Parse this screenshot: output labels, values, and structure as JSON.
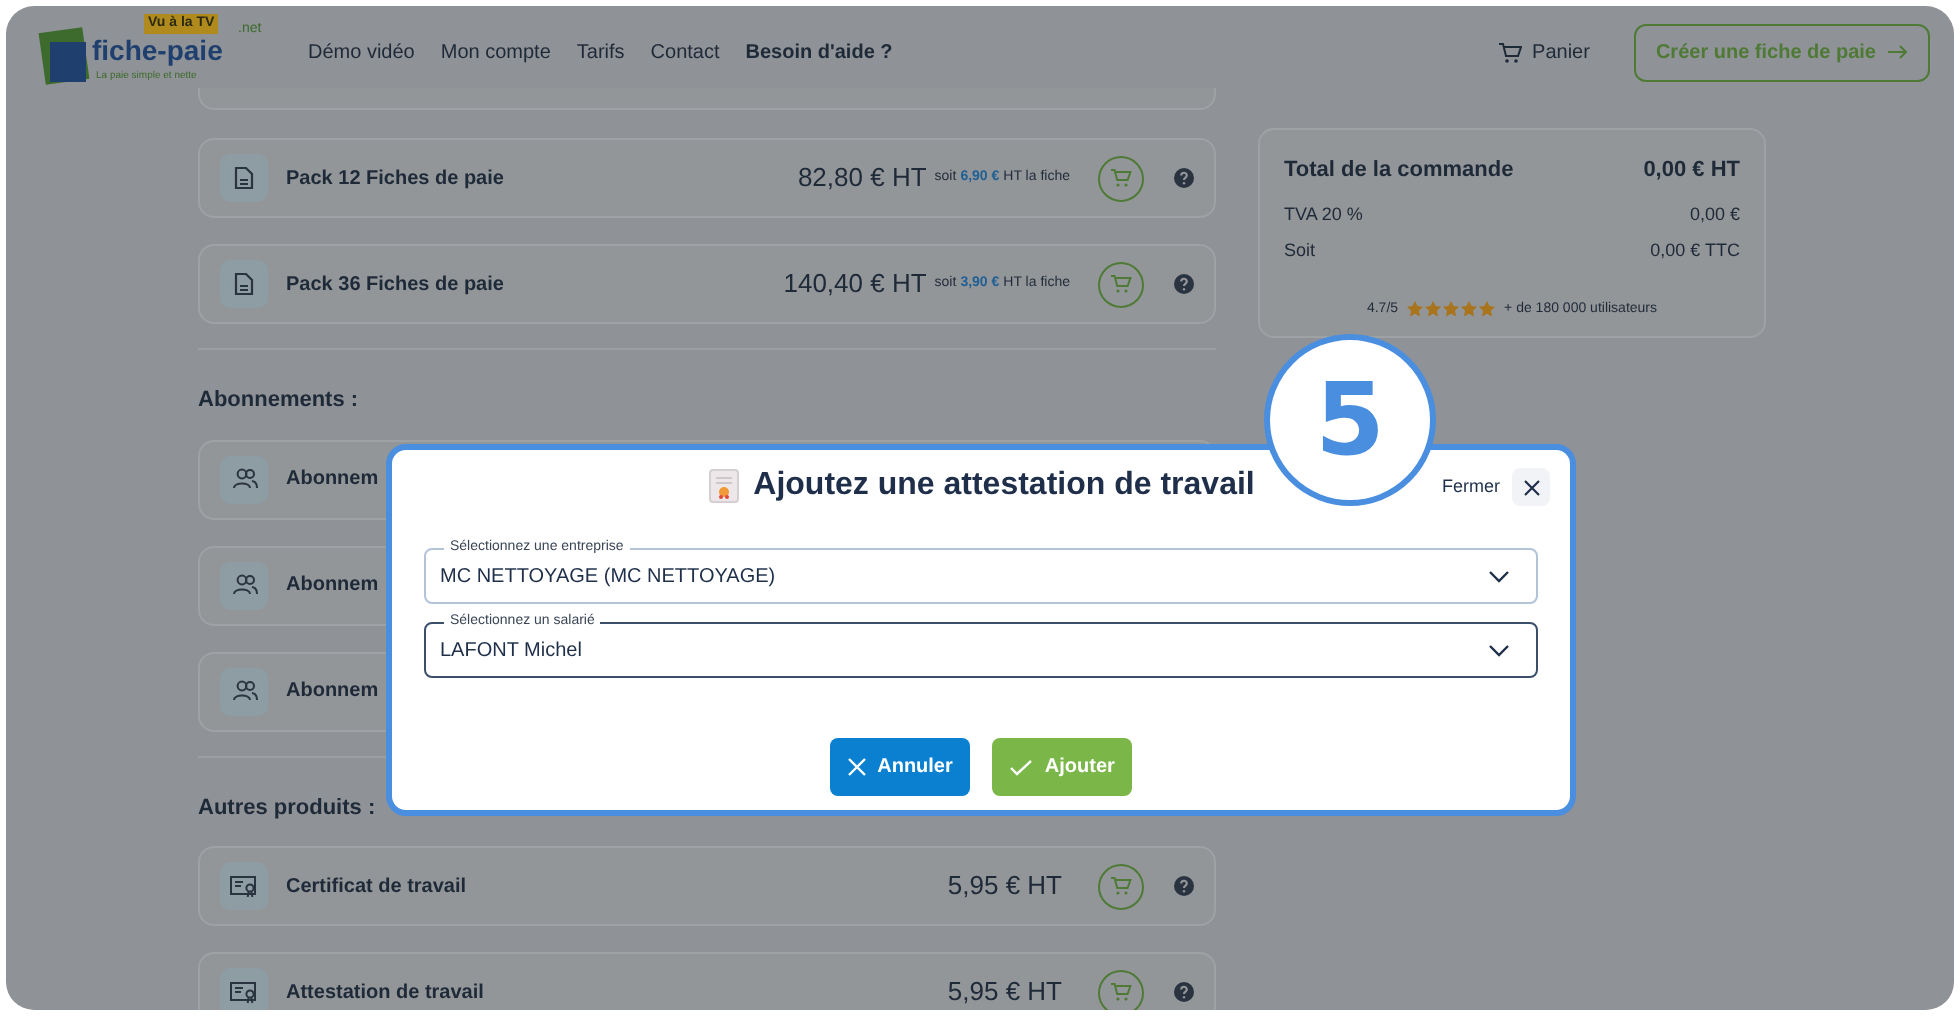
{
  "header": {
    "logo": {
      "badge": "Vu à la TV",
      "name": "fiche-paie",
      "suffix": ".net",
      "tagline": "La paie simple et nette"
    },
    "nav": [
      {
        "label": "Démo vidéo",
        "bold": false
      },
      {
        "label": "Mon compte",
        "bold": false
      },
      {
        "label": "Tarifs",
        "bold": false
      },
      {
        "label": "Contact",
        "bold": false
      },
      {
        "label": "Besoin d'aide ?",
        "bold": true
      }
    ],
    "cart": "Panier",
    "cta": "Créer une fiche de paie"
  },
  "sections": [
    {
      "items": [
        {
          "kind": "pack",
          "name": "Pack 12 Fiches de paie",
          "price": "82,80 € HT",
          "unit_prefix": "soit",
          "unit_price": "6,90 €",
          "unit_suffix": "HT la fiche"
        },
        {
          "kind": "pack",
          "name": "Pack 36 Fiches de paie",
          "price": "140,40 € HT",
          "unit_prefix": "soit",
          "unit_price": "3,90 €",
          "unit_suffix": "HT la fiche"
        }
      ]
    },
    {
      "title": "Abonnements :",
      "items": [
        {
          "kind": "subscription",
          "name": "Abonnem"
        },
        {
          "kind": "subscription",
          "name": "Abonnem"
        },
        {
          "kind": "subscription",
          "name": "Abonnem"
        }
      ]
    },
    {
      "title": "Autres produits :",
      "items": [
        {
          "kind": "document",
          "name": "Certificat de travail",
          "price": "5,95 € HT"
        },
        {
          "kind": "document",
          "name": "Attestation de travail",
          "price": "5,95 € HT"
        }
      ]
    }
  ],
  "summary": {
    "rows": [
      {
        "kind": "total",
        "label": "Total de la commande",
        "value": "0,00 € HT"
      },
      {
        "kind": "line",
        "label": "TVA 20 %",
        "value": "0,00 €"
      },
      {
        "kind": "line",
        "label": "Soit",
        "value": "0,00 € TTC"
      }
    ],
    "rating": "4.7/5",
    "stars": 5,
    "users": "+ de 180 000 utilisateurs"
  },
  "modal": {
    "title": "Ajoutez une attestation de travail",
    "close_label": "Fermer",
    "fields": [
      {
        "label": "Sélectionnez une entreprise",
        "value": "MC NETTOYAGE (MC NETTOYAGE)",
        "focused": false
      },
      {
        "label": "Sélectionnez un salarié",
        "value": "LAFONT Michel",
        "focused": true
      }
    ],
    "buttons": [
      {
        "kind": "cancel",
        "label": "Annuler"
      },
      {
        "kind": "confirm",
        "label": "Ajouter"
      }
    ]
  },
  "step_badge": "5"
}
